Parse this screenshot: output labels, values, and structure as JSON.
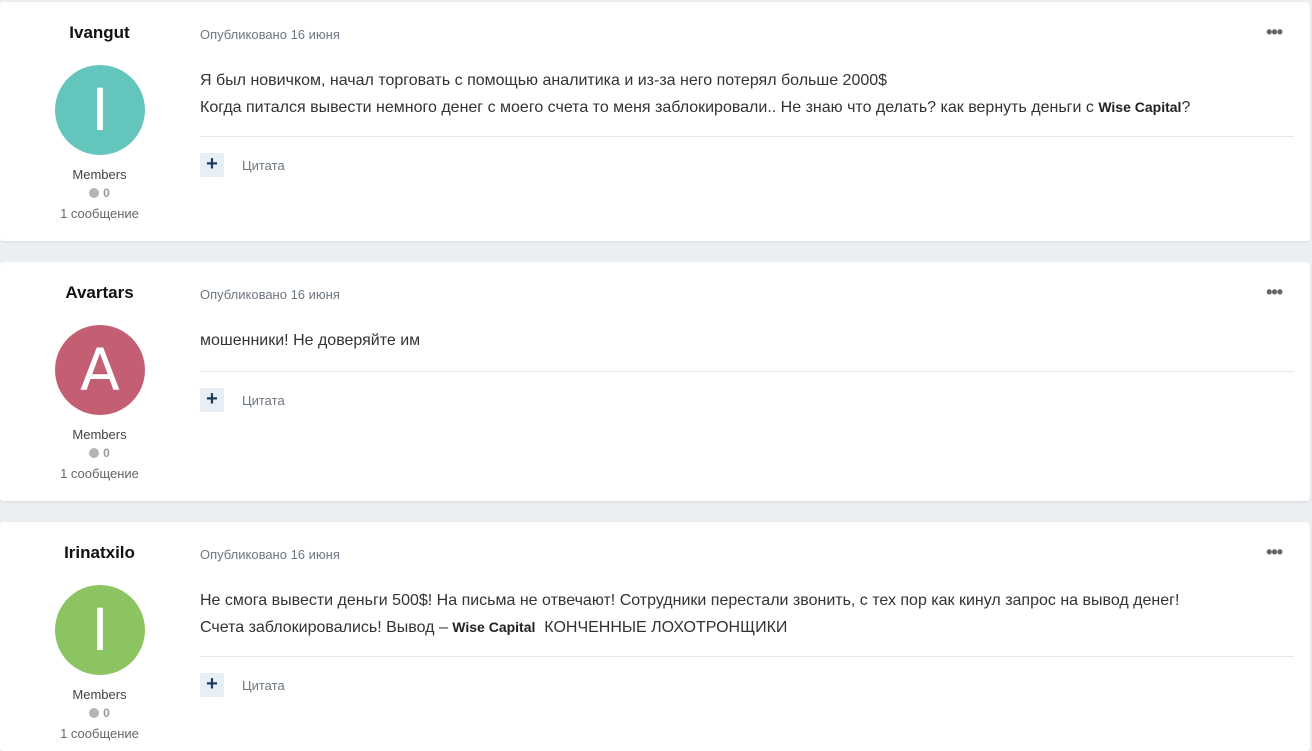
{
  "posts": [
    {
      "author": "Ivangut",
      "avatar_letter": "I",
      "avatar_color": "#64c5bd",
      "group": "Members",
      "reputation": "0",
      "posts_count": "1 сообщение",
      "published": "Опубликовано 16 июня",
      "menu_icon": "ellipsis-icon",
      "lines": [
        {
          "pre": "Я был новичком, начал торговать с помощью аналитика и из-за него потерял больше 2000$",
          "bold": "",
          "post": ""
        },
        {
          "pre": "Когда питался вывести немного денег с моего счета то меня заблокировали.. Не знаю что делать? как вернуть деньги с ",
          "bold": "Wise Capital",
          "post": "?"
        }
      ],
      "quote_label": "Цитата"
    },
    {
      "author": "Avartars",
      "avatar_letter": "A",
      "avatar_color": "#c45f73",
      "group": "Members",
      "reputation": "0",
      "posts_count": "1 сообщение",
      "published": "Опубликовано 16 июня",
      "menu_icon": "ellipsis-icon",
      "lines": [
        {
          "pre": "мошенники! Не доверяйте им",
          "bold": "",
          "post": ""
        }
      ],
      "quote_label": "Цитата"
    },
    {
      "author": "Irinatxilo",
      "avatar_letter": "I",
      "avatar_color": "#8bc461",
      "group": "Members",
      "reputation": "0",
      "posts_count": "1 сообщение",
      "published": "Опубликовано 16 июня",
      "menu_icon": "ellipsis-icon",
      "lines": [
        {
          "pre": "Не смога вывести деньги 500$! На письма не отвечают! Сотрудники перестали звонить, с тех пор как кинул запрос на вывод денег!",
          "bold": "",
          "post": ""
        },
        {
          "pre": "Счета заблокировались! Вывод – ",
          "bold": "Wise Capital",
          "post": "  КОНЧЕННЫЕ ЛОХОТРОНЩИКИ"
        }
      ],
      "quote_label": "Цитата"
    }
  ]
}
